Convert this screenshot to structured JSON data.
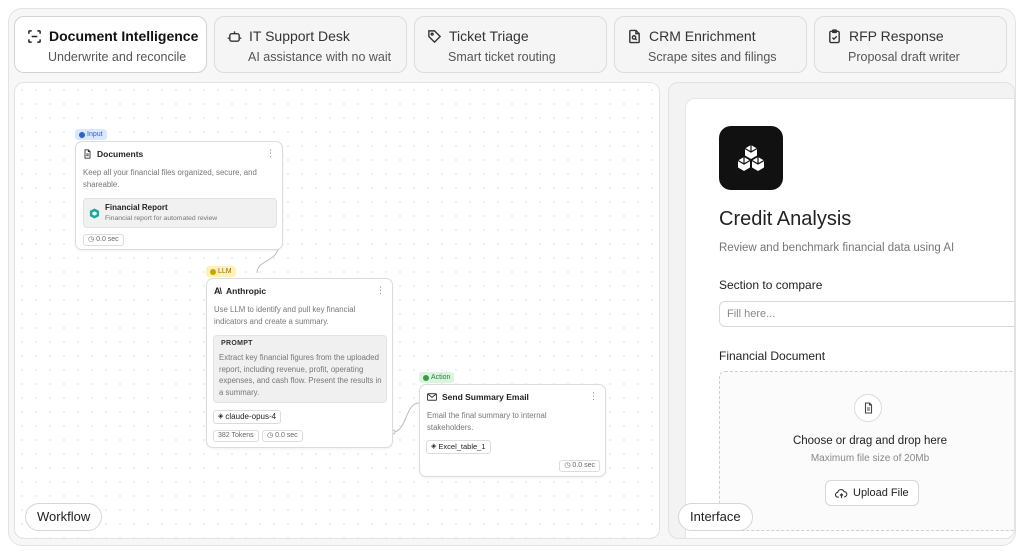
{
  "tabs": [
    {
      "title": "Document Intelligence",
      "subtitle": "Underwrite and reconcile",
      "icon": "scan-text-icon",
      "active": true
    },
    {
      "title": "IT Support Desk",
      "subtitle": "AI assistance with no wait",
      "icon": "bot-icon",
      "active": false
    },
    {
      "title": "Ticket Triage",
      "subtitle": "Smart ticket routing",
      "icon": "tag-icon",
      "active": false
    },
    {
      "title": "CRM Enrichment",
      "subtitle": "Scrape sites and filings",
      "icon": "file-search-icon",
      "active": false
    },
    {
      "title": "RFP Response",
      "subtitle": "Proposal draft writer",
      "icon": "clipboard-check-icon",
      "active": false
    }
  ],
  "workflow": {
    "label": "Workflow",
    "nodes": {
      "documents": {
        "badge": "Input",
        "title": "Documents",
        "description": "Keep all your financial files organized, secure, and shareable.",
        "file_title": "Financial Report",
        "file_desc": "Financial report for automated review",
        "time": "0.0 sec"
      },
      "anthropic": {
        "badge": "LLM",
        "title": "Anthropic",
        "description": "Use LLM to identify and pull key financial indicators and create a summary.",
        "prompt_label": "PROMPT",
        "prompt_text": "Extract key financial figures from the uploaded report, including revenue, profit, operating expenses, and cash flow. Present the results in a summary.",
        "model": "claude-opus-4",
        "tokens": "382 Tokens",
        "time": "0.0 sec"
      },
      "email": {
        "badge": "Action",
        "title": "Send Summary Email",
        "description": "Email the final summary to internal stakeholders.",
        "attachment": "Excel_table_1",
        "time": "0.0 sec"
      }
    }
  },
  "interface": {
    "label": "Interface",
    "title": "Credit Analysis",
    "subtitle": "Review and benchmark financial data using AI",
    "section_label": "Section to compare",
    "section_placeholder": "Fill here...",
    "document_label": "Financial Document",
    "drop_title": "Choose or drag and drop here",
    "drop_sub": "Maximum file size of 20Mb",
    "upload_label": "Upload File"
  },
  "colors": {
    "input_badge_bg": "#dbe7ff",
    "input_badge_fg": "#2f5fd0",
    "llm_badge_bg": "#fff1b8",
    "llm_badge_fg": "#8a6a00",
    "action_badge_bg": "#d9f5dd",
    "action_badge_fg": "#2f7d3c",
    "accent_file": "#1aa89a"
  }
}
